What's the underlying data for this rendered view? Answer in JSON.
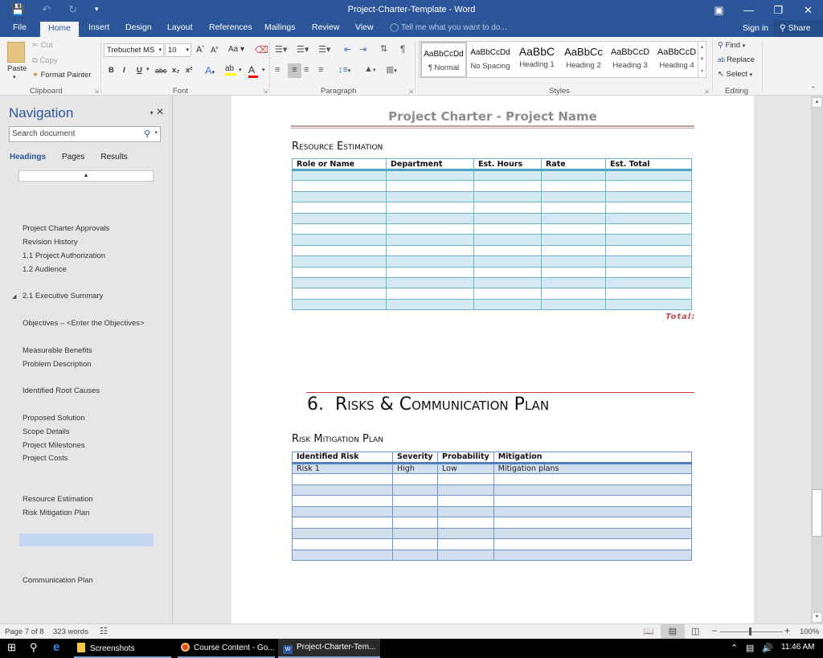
{
  "window": {
    "title": "Project-Charter-Template - Word",
    "controls": [
      "ribbon-display",
      "minimize",
      "restore",
      "close"
    ]
  },
  "ribbon_tabs": [
    "File",
    "Home",
    "Insert",
    "Design",
    "Layout",
    "References",
    "Mailings",
    "Review",
    "View"
  ],
  "active_tab": "Home",
  "tell_me": "Tell me what you want to do...",
  "sign_in": "Sign in",
  "share": "Share",
  "clipboard": {
    "paste": "Paste",
    "cut": "Cut",
    "copy": "Copy",
    "format_painter": "Format Painter",
    "label": "Clipboard"
  },
  "font": {
    "name": "Trebuchet MS",
    "size": "10",
    "label": "Font",
    "bold": "B",
    "italic": "I",
    "underline": "U",
    "strikethrough": "abc",
    "subscript": "x₂",
    "superscript": "x²",
    "grow": "A˄",
    "shrink": "A˅",
    "change_case": "Aa",
    "colors": {
      "highlight": "#ffff00",
      "font_color": "#ff0000"
    }
  },
  "paragraph": {
    "label": "Paragraph"
  },
  "styles": {
    "label": "Styles",
    "items": [
      {
        "preview": "AaBbCcDd",
        "name": "¶ Normal"
      },
      {
        "preview": "AaBbCcDd",
        "name": "No Spacing"
      },
      {
        "preview": "AaBbC",
        "name": "Heading 1"
      },
      {
        "preview": "AaBbCc",
        "name": "Heading 2"
      },
      {
        "preview": "AaBbCcD",
        "name": "Heading 3"
      },
      {
        "preview": "AaBbCcD",
        "name": "Heading 4"
      }
    ]
  },
  "editing": {
    "find": "Find",
    "replace": "Replace",
    "select": "Select",
    "label": "Editing"
  },
  "navigation": {
    "title": "Navigation",
    "search_placeholder": "Search document",
    "tabs": [
      "Headings",
      "Pages",
      "Results"
    ],
    "active_tab": "Headings",
    "items": [
      "Project Charter Approvals",
      "Revision History",
      "1.1 Project Authorization",
      "1.2  Audience",
      "2.1 Executive Summary",
      "Objectives – <Enter the Objectives>",
      "Measurable Benefits",
      "Problem Description",
      "Identified Root Causes",
      "Proposed Solution",
      "Scope Details",
      "Project Milestones",
      "Project Costs",
      "Resource Estimation",
      "Risk Mitigation Plan",
      "Communication Plan"
    ]
  },
  "document": {
    "header_title": "Project Charter - Project Name",
    "resource_section": "Resource Estimation",
    "resource_table": {
      "headers": [
        "Role or Name",
        "Department",
        "Est. Hours",
        "Rate",
        "Est. Total"
      ],
      "empty_rows": 13
    },
    "total_label": "Total:",
    "heading1_number": "6.",
    "heading1_text": "Risks & Communication Plan",
    "risk_section": "Risk Mitigation Plan",
    "risk_table": {
      "headers": [
        "Identified Risk",
        "Severity",
        "Probability",
        "Mitigation"
      ],
      "rows": [
        [
          "Risk 1",
          "High",
          "Low",
          "Mitigation plans"
        ]
      ],
      "empty_rows": 8
    }
  },
  "status": {
    "page": "Page 7 of 8",
    "words": "323 words",
    "zoom": "100%"
  },
  "taskbar": {
    "items": [
      "Screenshots",
      "Course Content - Go...",
      "Project-Charter-Tem..."
    ],
    "time": "11:46 AM"
  }
}
